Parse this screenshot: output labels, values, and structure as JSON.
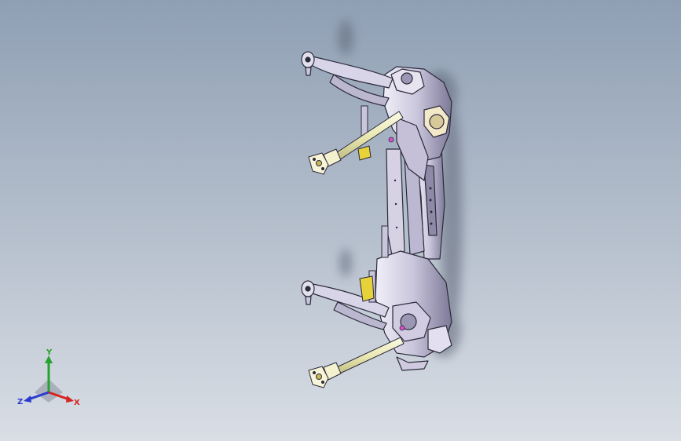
{
  "viewport": {
    "background_top": "#8f9fb4",
    "background_bottom": "#d9dee5"
  },
  "model": {
    "icon": "subframe-assembly-model",
    "colors": {
      "frame": "#d8d4e6",
      "frame_dark": "#6d6a86",
      "edge": "#2b2a3a",
      "shaft": "#efeec0",
      "bracket": "#e8d23a",
      "accent": "#d94fd0"
    }
  },
  "triad": {
    "x_label": "X",
    "y_label": "Y",
    "z_label": "Z",
    "x_color": "#d42424",
    "y_color": "#25a32c",
    "z_color": "#2a3bd0"
  }
}
